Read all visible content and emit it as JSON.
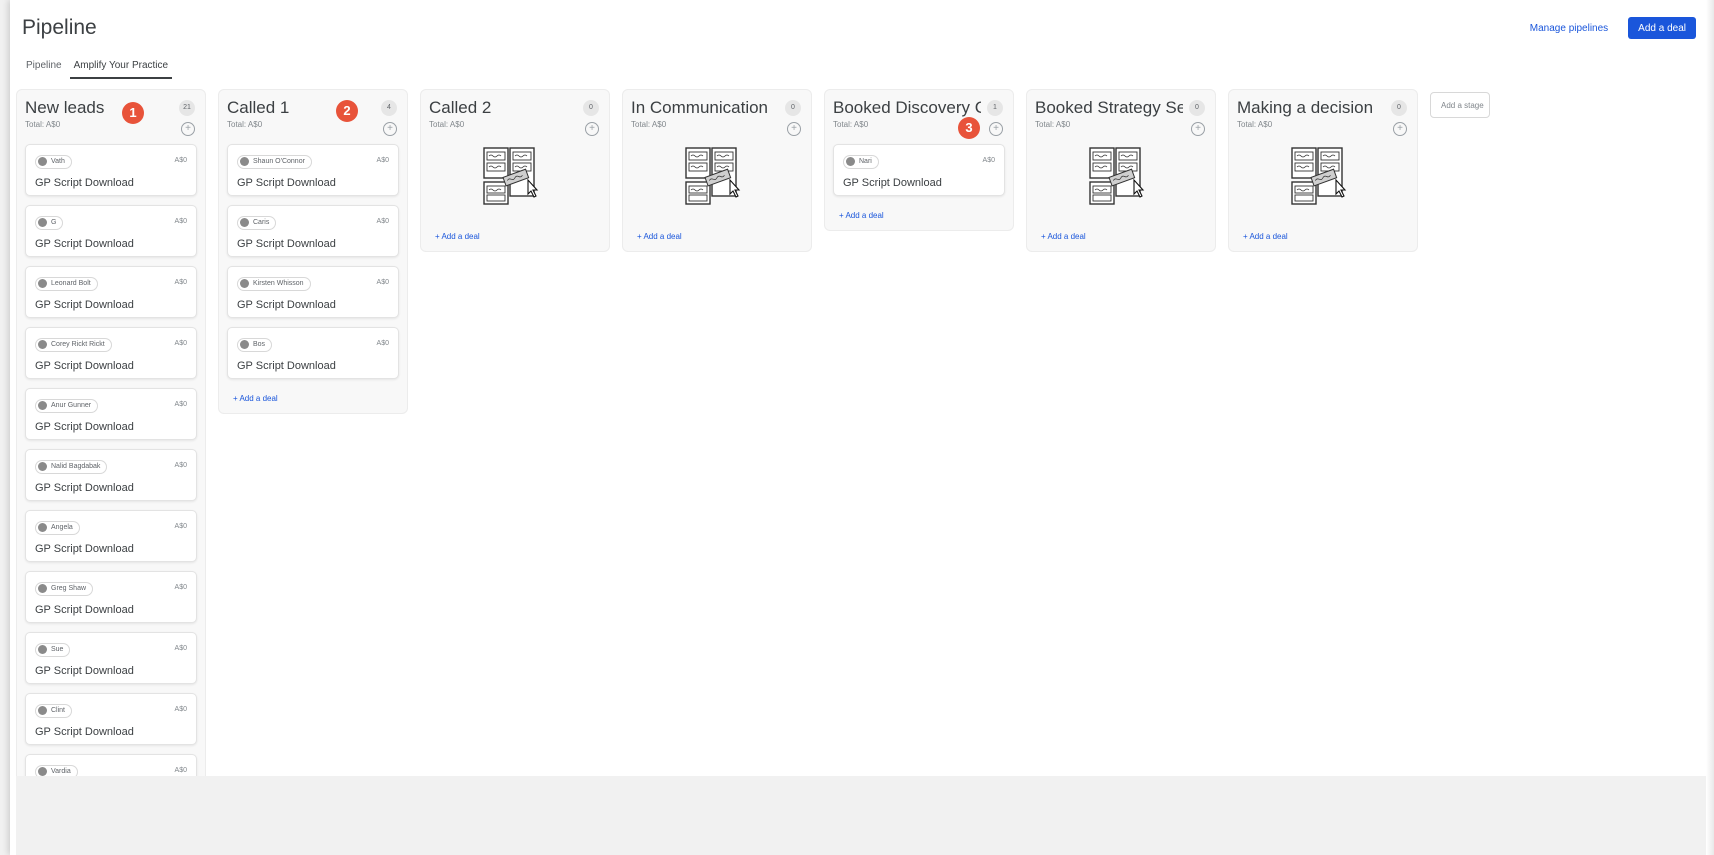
{
  "header": {
    "title": "Pipeline",
    "manage_label": "Manage pipelines",
    "add_deal_label": "Add a deal"
  },
  "tabs": [
    {
      "label": "Pipeline"
    },
    {
      "label": "Amplify Your Practice"
    }
  ],
  "columns": [
    {
      "title": "New leads",
      "total": "Total: A$0",
      "count": "21",
      "deals": [
        {
          "contact": "Vath",
          "value": "A$0",
          "title": "GP Script Download"
        },
        {
          "contact": "G",
          "value": "A$0",
          "title": "GP Script Download"
        },
        {
          "contact": "Leonard Bolt",
          "value": "A$0",
          "title": "GP Script Download"
        },
        {
          "contact": "Corey Rickt Rickt",
          "value": "A$0",
          "title": "GP Script Download"
        },
        {
          "contact": "Anur Gunner",
          "value": "A$0",
          "title": "GP Script Download"
        },
        {
          "contact": "Nalid Bagdabak",
          "value": "A$0",
          "title": "GP Script Download"
        },
        {
          "contact": "Angela",
          "value": "A$0",
          "title": "GP Script Download"
        },
        {
          "contact": "Greg Shaw",
          "value": "A$0",
          "title": "GP Script Download"
        },
        {
          "contact": "Sue",
          "value": "A$0",
          "title": "GP Script Download"
        },
        {
          "contact": "Clint",
          "value": "A$0",
          "title": "GP Script Download"
        },
        {
          "contact": "Vardia",
          "value": "A$0",
          "title": ""
        }
      ]
    },
    {
      "title": "Called 1",
      "total": "Total: A$0",
      "count": "4",
      "deals": [
        {
          "contact": "Shaun O'Connor",
          "value": "A$0",
          "title": "GP Script Download"
        },
        {
          "contact": "Caris",
          "value": "A$0",
          "title": "GP Script Download"
        },
        {
          "contact": "Kirsten Whisson",
          "value": "A$0",
          "title": "GP Script Download"
        },
        {
          "contact": "Bos",
          "value": "A$0",
          "title": "GP Script Download"
        }
      ],
      "add_label": "+ Add a deal"
    },
    {
      "title": "Called 2",
      "total": "Total: A$0",
      "count": "0",
      "deals": [],
      "add_label": "+ Add a deal"
    },
    {
      "title": "In Communication",
      "total": "Total: A$0",
      "count": "0",
      "deals": [],
      "add_label": "+ Add a deal"
    },
    {
      "title": "Booked Discovery Call",
      "total": "Total: A$0",
      "count": "1",
      "deals": [
        {
          "contact": "Nari",
          "value": "A$0",
          "title": "GP Script Download"
        }
      ],
      "add_label": "+ Add a deal"
    },
    {
      "title": "Booked Strategy Session",
      "total": "Total: A$0",
      "count": "0",
      "deals": [],
      "add_label": "+ Add a deal"
    },
    {
      "title": "Making a decision",
      "total": "Total: A$0",
      "count": "0",
      "deals": [],
      "add_label": "+ Add a deal"
    }
  ],
  "add_stage_label": "Add a stage",
  "markers": [
    "1",
    "2",
    "3"
  ],
  "icons": {
    "column_add": "plus-circle-icon",
    "contact": "person-icon",
    "empty_state": "kanban-cards-illustration-icon"
  },
  "colors": {
    "accent": "#1a56db",
    "marker": "#e8533a"
  }
}
